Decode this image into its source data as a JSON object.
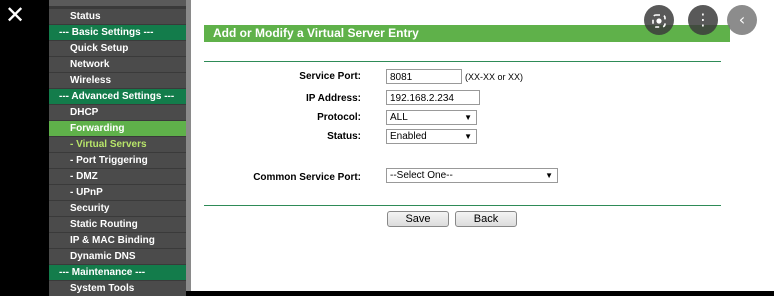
{
  "viewer": {
    "close_icon": "close-icon"
  },
  "sidebar": {
    "items": [
      {
        "label": "Status",
        "kind": "normal"
      },
      {
        "label": "--- Basic Settings ---",
        "kind": "section"
      },
      {
        "label": "Quick Setup",
        "kind": "normal"
      },
      {
        "label": "Network",
        "kind": "normal"
      },
      {
        "label": "Wireless",
        "kind": "normal"
      },
      {
        "label": "--- Advanced Settings ---",
        "kind": "section"
      },
      {
        "label": "DHCP",
        "kind": "normal"
      },
      {
        "label": "Forwarding",
        "kind": "active"
      },
      {
        "label": "- Virtual Servers",
        "kind": "sub-selected"
      },
      {
        "label": "- Port Triggering",
        "kind": "sub"
      },
      {
        "label": "- DMZ",
        "kind": "sub"
      },
      {
        "label": "- UPnP",
        "kind": "sub"
      },
      {
        "label": "Security",
        "kind": "normal"
      },
      {
        "label": "Static Routing",
        "kind": "normal"
      },
      {
        "label": "IP & MAC Binding",
        "kind": "normal"
      },
      {
        "label": "Dynamic DNS",
        "kind": "normal"
      },
      {
        "label": "--- Maintenance ---",
        "kind": "section"
      },
      {
        "label": "System Tools",
        "kind": "normal"
      }
    ]
  },
  "form": {
    "title": "Add or Modify a Virtual Server Entry",
    "service_port_label": "Service Port:",
    "service_port_value": "8081",
    "service_port_hint": "(XX-XX or XX)",
    "ip_label": "IP Address:",
    "ip_value": "192.168.2.234",
    "protocol_label": "Protocol:",
    "protocol_value": "ALL",
    "status_label": "Status:",
    "status_value": "Enabled",
    "common_port_label": "Common Service Port:",
    "common_port_value": "--Select One--",
    "save_label": "Save",
    "back_label": "Back"
  },
  "overlay": {
    "lens_icon": "lens-icon",
    "more_icon": "more-vert-icon",
    "back_icon": "chevron-left-icon"
  },
  "colors": {
    "section_green": "#137c4b",
    "active_green": "#5fb14a",
    "selected_text": "#b8e56a"
  }
}
